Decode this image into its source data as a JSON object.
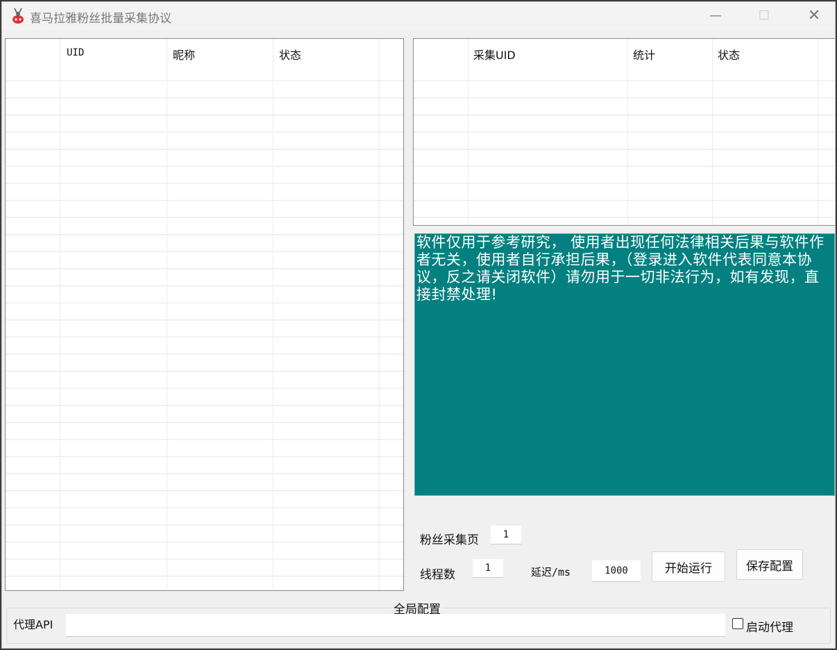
{
  "window": {
    "title": "喜马拉雅粉丝批量采集协议",
    "minimize_glyph": "—",
    "maximize_glyph": "☐",
    "close_glyph": "✕"
  },
  "left_table": {
    "columns": [
      "UID",
      "昵称",
      "状态"
    ],
    "rows": []
  },
  "right_table": {
    "columns": [
      "采集UID",
      "统计",
      "状态"
    ],
    "rows": []
  },
  "notice": {
    "text": "软件仅用于参考研究， 使用者出现任何法律相关后果与软件作者无关，使用者自行承担后果，（登录进入软件代表同意本协议，反之请关闭软件）请勿用于一切非法行为，如有发现，直接封禁处理!",
    "background": "#048080"
  },
  "config": {
    "fans_page_label": "粉丝采集页",
    "fans_page_value": "1",
    "threads_label": "线程数",
    "threads_value": "1",
    "delay_label": "延迟/ms",
    "delay_value": "1000",
    "start_button": "开始运行",
    "save_button": "保存配置"
  },
  "global_config": {
    "title": "全局配置",
    "proxy_api_label": "代理API",
    "proxy_api_value": "",
    "enable_proxy_label": "启动代理",
    "enable_proxy_checked": false
  }
}
